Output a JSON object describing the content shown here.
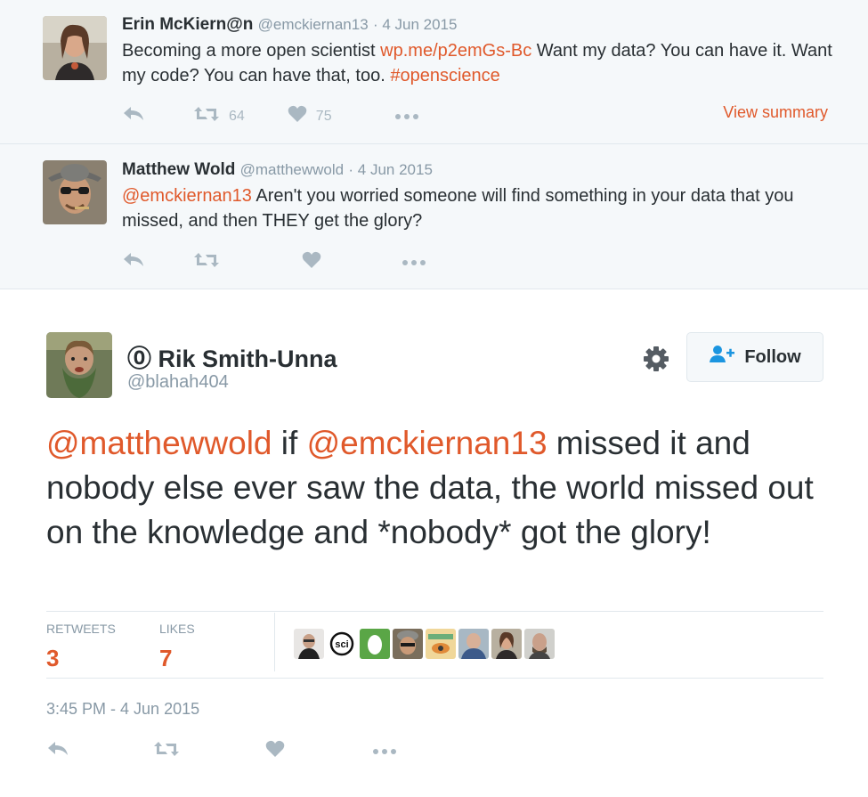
{
  "tweet1": {
    "fullname": "Erin McKiern@n",
    "handle": "@emckiernan13",
    "date": "· 4 Jun 2015",
    "text_before": "Becoming a more open scientist ",
    "link": "wp.me/p2emGs-Bc",
    "text_middle": " Want my data? You can have it. Want my code? You can have that, too. ",
    "hashtag": "#openscience",
    "retweets": "64",
    "likes": "75",
    "view_summary": "View summary"
  },
  "tweet2": {
    "fullname": "Matthew Wold",
    "handle": "@matthewwold",
    "date": "· 4 Jun 2015",
    "mention": "@emckiernan13",
    "text": " Aren't you worried someone will find something in your data that you missed, and then THEY get the glory?"
  },
  "main": {
    "fullname": "⓪ Rik Smith-Unna",
    "handle": "@blahah404",
    "follow_label": "Follow",
    "mention1": "@matthewwold",
    "text1": " if ",
    "mention2": "@emckiernan13",
    "text2": " missed it and nobody else ever saw the data, the world missed out on the knowledge and *nobody* got the glory!",
    "retweets_label": "RETWEETS",
    "retweets_value": "3",
    "likes_label": "LIKES",
    "likes_value": "7",
    "timestamp": "3:45 PM - 4 Jun 2015",
    "sci_badge": "sci"
  },
  "colors": {
    "accent": "#e0592b",
    "muted": "#8899a6",
    "icon": "#aab8c2",
    "background_context": "#f5f8fa"
  },
  "icons": {
    "reply": "reply-icon",
    "retweet": "retweet-icon",
    "like": "heart-icon",
    "more": "more-icon",
    "settings": "gear-icon",
    "follow": "follow-user-icon"
  }
}
